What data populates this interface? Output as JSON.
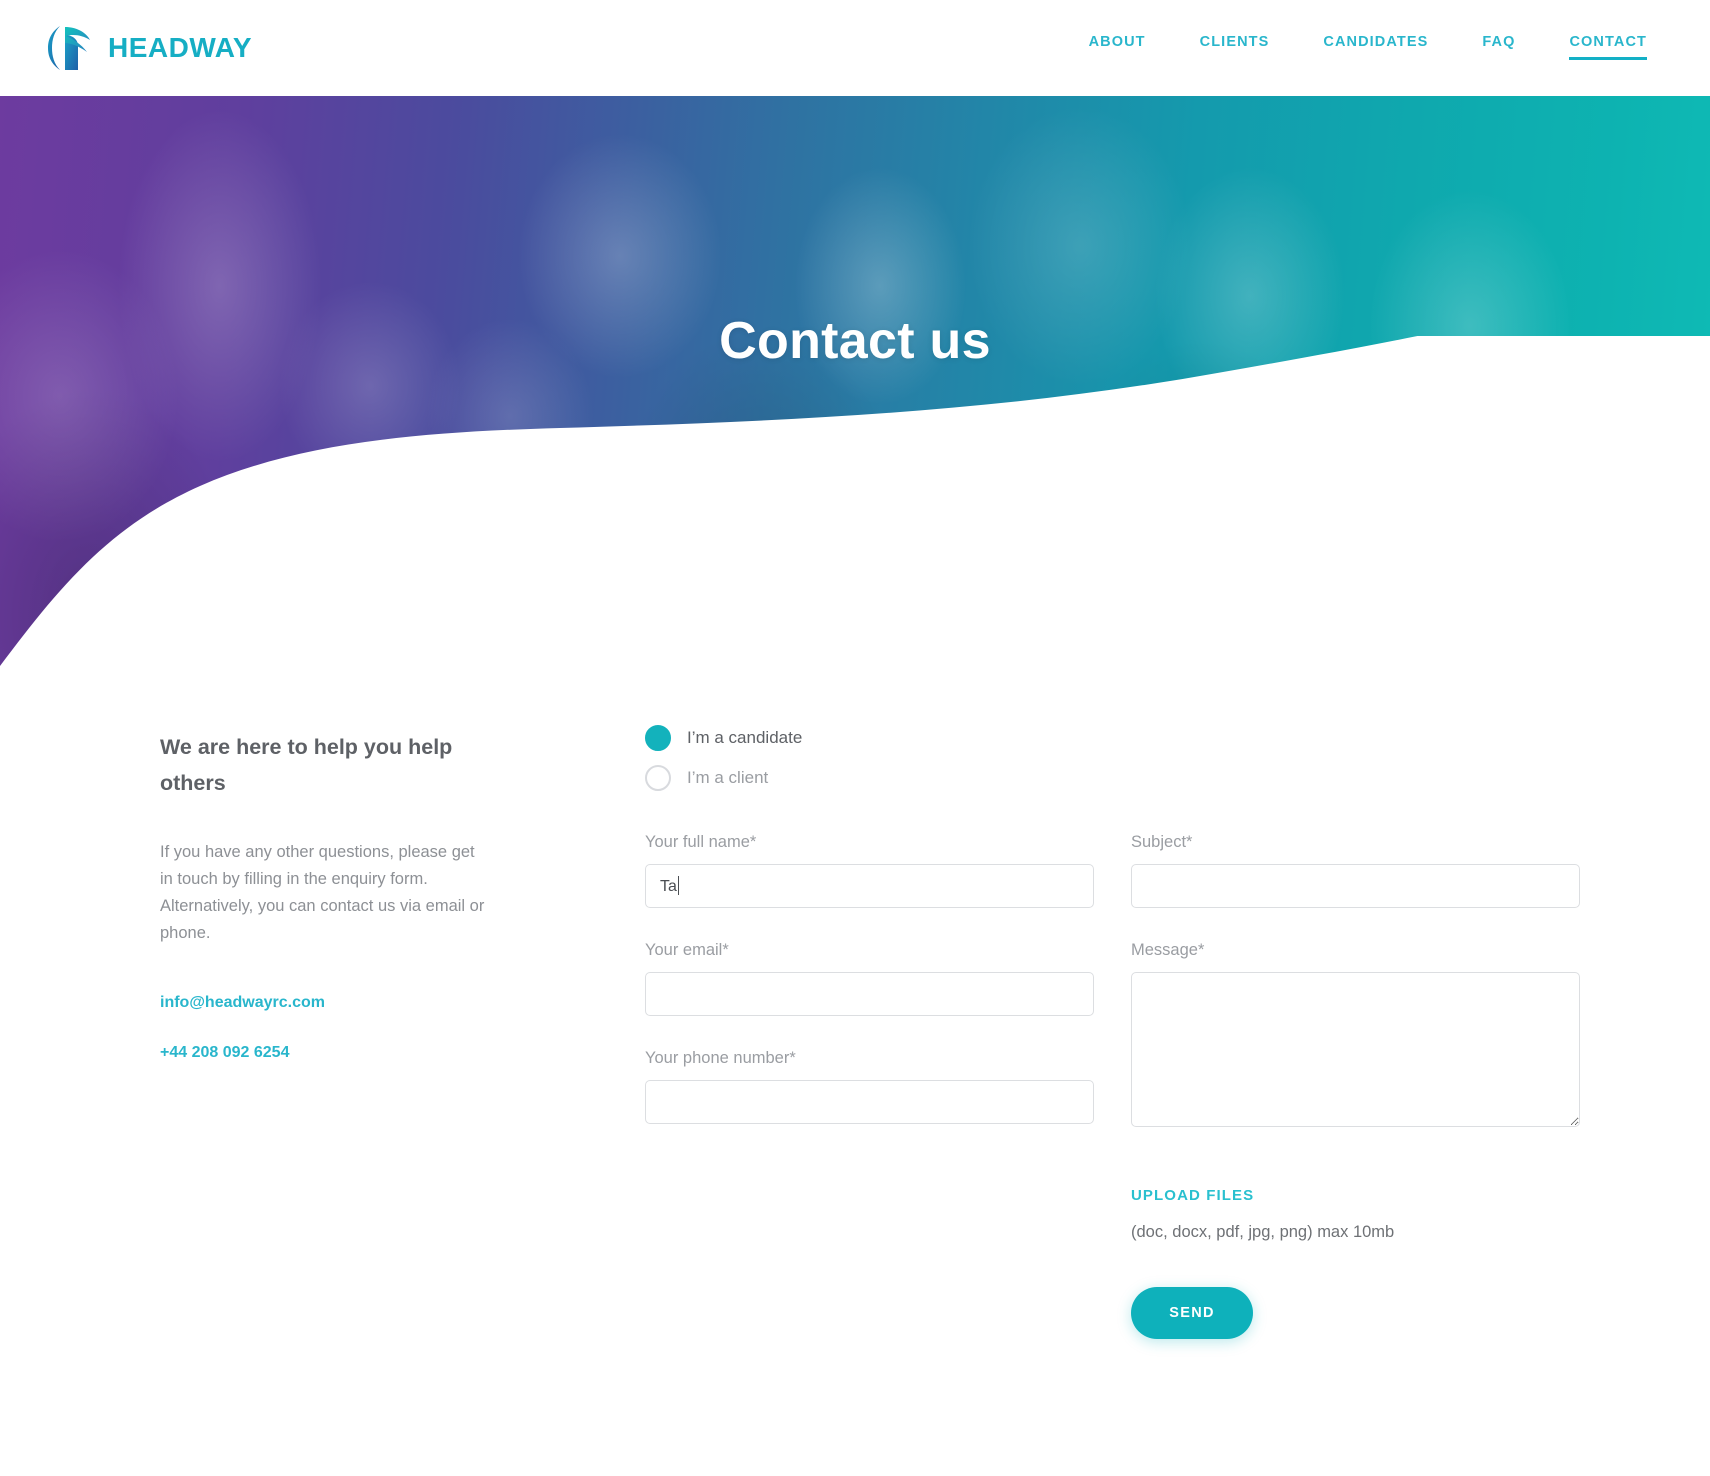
{
  "brand": {
    "name": "HEADWAY",
    "logo_icon": "headway-logo-mark",
    "accent_color": "#16aec4"
  },
  "nav": {
    "items": [
      {
        "label": "ABOUT",
        "active": false
      },
      {
        "label": "CLIENTS",
        "active": false
      },
      {
        "label": "CANDIDATES",
        "active": false
      },
      {
        "label": "FAQ",
        "active": false
      },
      {
        "label": "CONTACT",
        "active": true
      }
    ]
  },
  "hero": {
    "title": "Contact us",
    "gradient_from": "#6d3b9f",
    "gradient_to": "#0fbcb6"
  },
  "intro": {
    "heading": "We are here to help you help others",
    "paragraph": "If you have any other questions, please get in touch by filling in the enquiry form. Alternatively, you can contact us via email or phone.",
    "email": "info@headwayrc.com",
    "phone": "+44 208 092 6254"
  },
  "form": {
    "radios": [
      {
        "label": "I’m a candidate",
        "checked": true
      },
      {
        "label": "I’m a client",
        "checked": false
      }
    ],
    "fields": {
      "full_name": {
        "label": "Your full name*",
        "value": "Ta",
        "placeholder": "",
        "focused": true
      },
      "email": {
        "label": "Your email*",
        "value": "",
        "placeholder": ""
      },
      "phone": {
        "label": "Your phone number*",
        "value": "",
        "placeholder": ""
      },
      "subject": {
        "label": "Subject*",
        "value": "",
        "placeholder": ""
      },
      "message": {
        "label": "Message*",
        "value": "",
        "placeholder": ""
      }
    },
    "upload": {
      "link_label": "UPLOAD FILES",
      "hint": "(doc, docx, pdf, jpg, png) max 10mb"
    },
    "submit_label": "SEND",
    "submit_color": "#0eb1bb",
    "focus_border_color": "#25b9d0",
    "radio_checked_color": "#13b2bc"
  }
}
